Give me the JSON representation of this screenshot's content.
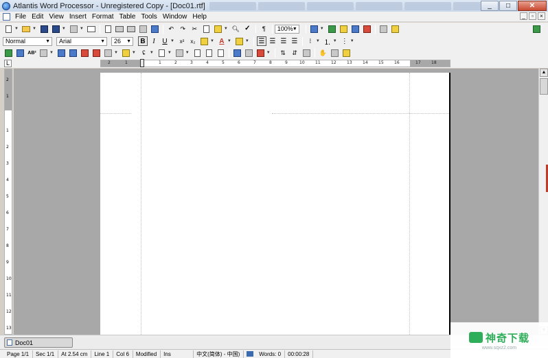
{
  "window": {
    "title": "Atlantis Word Processor - Unregistered Copy - [Doc01.rtf]",
    "controls": [
      "_",
      "□",
      "✕"
    ]
  },
  "menu": {
    "items": [
      "File",
      "Edit",
      "View",
      "Insert",
      "Format",
      "Table",
      "Tools",
      "Window",
      "Help"
    ],
    "mdi_controls": [
      "_",
      "▫",
      "×"
    ]
  },
  "toolbar_standard": {
    "zoom": "100%",
    "paragraph_mark": "¶"
  },
  "toolbar_format": {
    "style": "Normal",
    "font": "Arial",
    "size": "26",
    "bold": "B",
    "italic": "I",
    "underline": "U",
    "superscript": "x²",
    "subscript": "x₂",
    "font_color_letter": "A"
  },
  "ruler": {
    "ticks": [
      "2",
      "1",
      "1",
      "2",
      "3",
      "4",
      "5",
      "6",
      "7",
      "8",
      "9",
      "10",
      "11",
      "12",
      "13",
      "14",
      "15",
      "16",
      "17",
      "18"
    ],
    "vticks": [
      "2",
      "1",
      "1",
      "2",
      "3",
      "4",
      "5",
      "6",
      "7",
      "8",
      "9",
      "10",
      "11",
      "12",
      "13"
    ],
    "tab_selector": "L"
  },
  "document": {
    "tab_label": "Doc01"
  },
  "status": {
    "page": "Page 1/1",
    "section": "Sec 1/1",
    "position": "At 2.54 cm",
    "line": "Line 1",
    "col": "Col 6",
    "modified": "Modified",
    "mode": "Ins",
    "ime": "中文(简体) - 中国)",
    "words": "Words: 0",
    "time": "00:00:28"
  },
  "watermark": {
    "name": "神奇下载",
    "url": "www.sqxz2.com"
  },
  "colors": {
    "workspace": "#a8a8a8",
    "brand_green": "#2fae5a"
  }
}
